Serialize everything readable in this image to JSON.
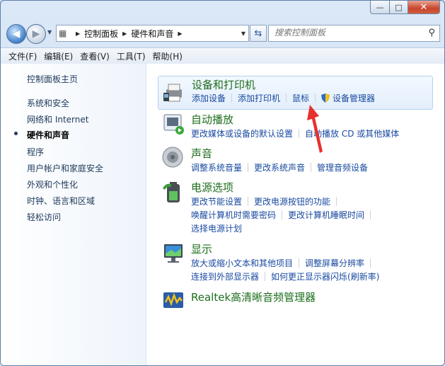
{
  "window": {
    "caption": {
      "minimize": "—",
      "maximize": "□",
      "close": "✕"
    }
  },
  "address": {
    "crumbs": [
      "控制面板",
      "硬件和声音"
    ],
    "search_placeholder": "搜索控制面板"
  },
  "menu": [
    "文件(F)",
    "编辑(E)",
    "查看(V)",
    "工具(T)",
    "帮助(H)"
  ],
  "left_nav": {
    "home": "控制面板主页",
    "items": [
      "系统和安全",
      "网络和 Internet",
      "硬件和声音",
      "程序",
      "用户帐户和家庭安全",
      "外观和个性化",
      "时钟、语言和区域",
      "轻松访问"
    ],
    "active_index": 2
  },
  "categories": {
    "devices": {
      "title": "设备和打印机",
      "links": [
        "添加设备",
        "添加打印机",
        "鼠标",
        "设备管理器"
      ]
    },
    "autoplay": {
      "title": "自动播放",
      "links": [
        "更改媒体或设备的默认设置",
        "自动播放 CD 或其他媒体"
      ]
    },
    "sound": {
      "title": "声音",
      "links": [
        "调整系统音量",
        "更改系统声音",
        "管理音频设备"
      ]
    },
    "power": {
      "title": "电源选项",
      "links": [
        "更改节能设置",
        "更改电源按钮的功能",
        "唤醒计算机时需要密码",
        "更改计算机睡眠时间",
        "选择电源计划"
      ]
    },
    "display": {
      "title": "显示",
      "links": [
        "放大或缩小文本和其他项目",
        "调整屏幕分辨率",
        "连接到外部显示器",
        "如何更正显示器闪烁(刷新率)"
      ]
    },
    "realtek": {
      "title": "Realtek高清晰音频管理器"
    }
  },
  "colors": {
    "link": "#1a4aa0",
    "category_title": "#1e6e1e",
    "annotation_arrow": "#e8302c"
  }
}
